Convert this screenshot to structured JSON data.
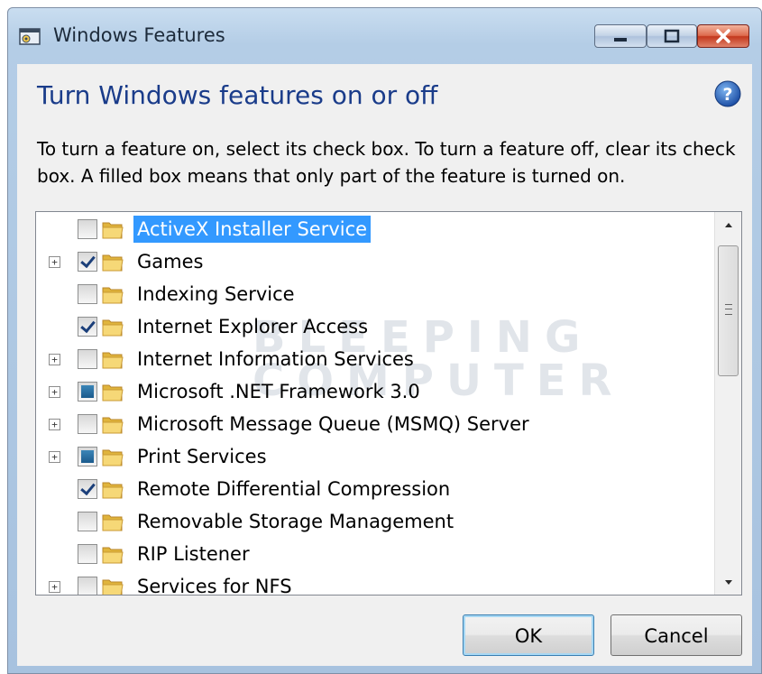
{
  "window": {
    "title": "Windows Features",
    "title_icon": "windows-features-app-icon"
  },
  "dialog": {
    "heading": "Turn Windows features on or off",
    "instruction": "To turn a feature on, select its check box. To turn a feature off, clear its check box. A filled box means that only part of the feature is turned on.",
    "help_icon": "help-question-icon"
  },
  "watermark": {
    "line1": "BLEEPING",
    "line2": "COMPUTER"
  },
  "features": [
    {
      "label": "ActiveX Installer Service",
      "state": "unchecked",
      "expandable": false,
      "selected": true
    },
    {
      "label": "Games",
      "state": "checked",
      "expandable": true,
      "selected": false
    },
    {
      "label": "Indexing Service",
      "state": "unchecked",
      "expandable": false,
      "selected": false
    },
    {
      "label": "Internet Explorer Access",
      "state": "checked",
      "expandable": false,
      "selected": false
    },
    {
      "label": "Internet Information Services",
      "state": "unchecked",
      "expandable": true,
      "selected": false
    },
    {
      "label": "Microsoft .NET Framework 3.0",
      "state": "partial",
      "expandable": true,
      "selected": false
    },
    {
      "label": "Microsoft Message Queue (MSMQ) Server",
      "state": "unchecked",
      "expandable": true,
      "selected": false
    },
    {
      "label": "Print Services",
      "state": "partial",
      "expandable": true,
      "selected": false
    },
    {
      "label": "Remote Differential Compression",
      "state": "checked",
      "expandable": false,
      "selected": false
    },
    {
      "label": "Removable Storage Management",
      "state": "unchecked",
      "expandable": false,
      "selected": false
    },
    {
      "label": "RIP Listener",
      "state": "unchecked",
      "expandable": false,
      "selected": false
    },
    {
      "label": "Services for NFS",
      "state": "unchecked",
      "expandable": true,
      "selected": false
    }
  ],
  "buttons": {
    "ok": "OK",
    "cancel": "Cancel"
  },
  "colors": {
    "heading": "#1a3c8a",
    "selection": "#3399ff"
  }
}
